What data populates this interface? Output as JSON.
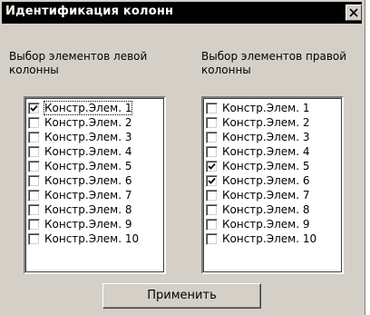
{
  "dialog": {
    "title": "Идентификация колонн",
    "apply_label": "Применить"
  },
  "left": {
    "label": "Выбор элементов левой\nколонны",
    "items": [
      {
        "label": "Констр.Элем. 1",
        "checked": true
      },
      {
        "label": "Констр.Элем. 2",
        "checked": false
      },
      {
        "label": "Констр.Элем. 3",
        "checked": false
      },
      {
        "label": "Констр.Элем. 4",
        "checked": false
      },
      {
        "label": "Констр.Элем. 5",
        "checked": false
      },
      {
        "label": "Констр.Элем. 6",
        "checked": false
      },
      {
        "label": "Констр.Элем. 7",
        "checked": false
      },
      {
        "label": "Констр.Элем. 8",
        "checked": false
      },
      {
        "label": "Констр.Элем. 9",
        "checked": false
      },
      {
        "label": "Констр.Элем. 10",
        "checked": false
      }
    ]
  },
  "right": {
    "label": "Выбор элементов правой\nколонны",
    "items": [
      {
        "label": "Констр.Элем. 1",
        "checked": false
      },
      {
        "label": "Констр.Элем. 2",
        "checked": false
      },
      {
        "label": "Констр.Элем. 3",
        "checked": false
      },
      {
        "label": "Констр.Элем. 4",
        "checked": false
      },
      {
        "label": "Констр.Элем. 5",
        "checked": true
      },
      {
        "label": "Констр.Элем. 6",
        "checked": true
      },
      {
        "label": "Констр.Элем. 7",
        "checked": false
      },
      {
        "label": "Констр.Элем. 8",
        "checked": false
      },
      {
        "label": "Констр.Элем. 9",
        "checked": false
      },
      {
        "label": "Констр.Элем. 10",
        "checked": false
      }
    ]
  }
}
